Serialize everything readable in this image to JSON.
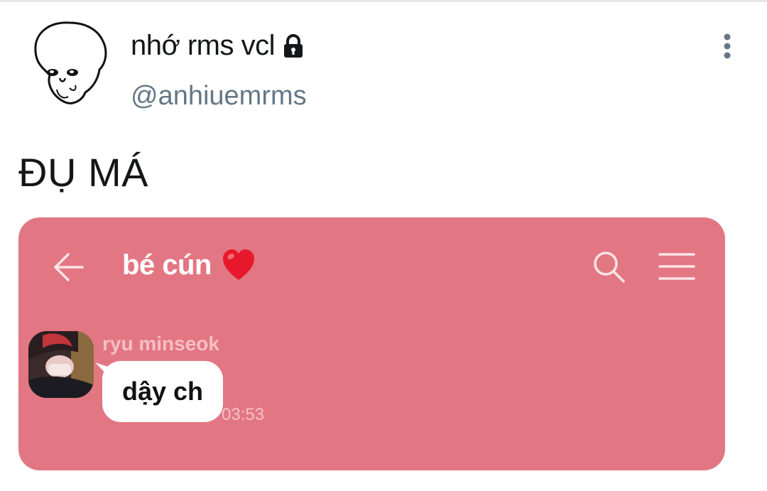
{
  "header": {
    "display_name": "nhớ rms vcl",
    "handle": "@anhiuemrms"
  },
  "tweet": {
    "text": "ĐỤ MÁ"
  },
  "chat": {
    "title": "bé cún",
    "message": {
      "sender": "ryu minseok",
      "text": "dậy ch",
      "time": "03:53"
    }
  },
  "icons": {
    "avatar": "blob-face-avatar",
    "protected": "lock-icon",
    "more": "more-vertical-icon",
    "back": "arrow-left-icon",
    "heart": "heart-emoji",
    "search": "search-icon",
    "menu": "hamburger-menu-icon"
  },
  "colors": {
    "chat_background": "#e27783",
    "handle": "#657786",
    "bubble": "#ffffff",
    "sender_name": "#f6bfc5"
  }
}
